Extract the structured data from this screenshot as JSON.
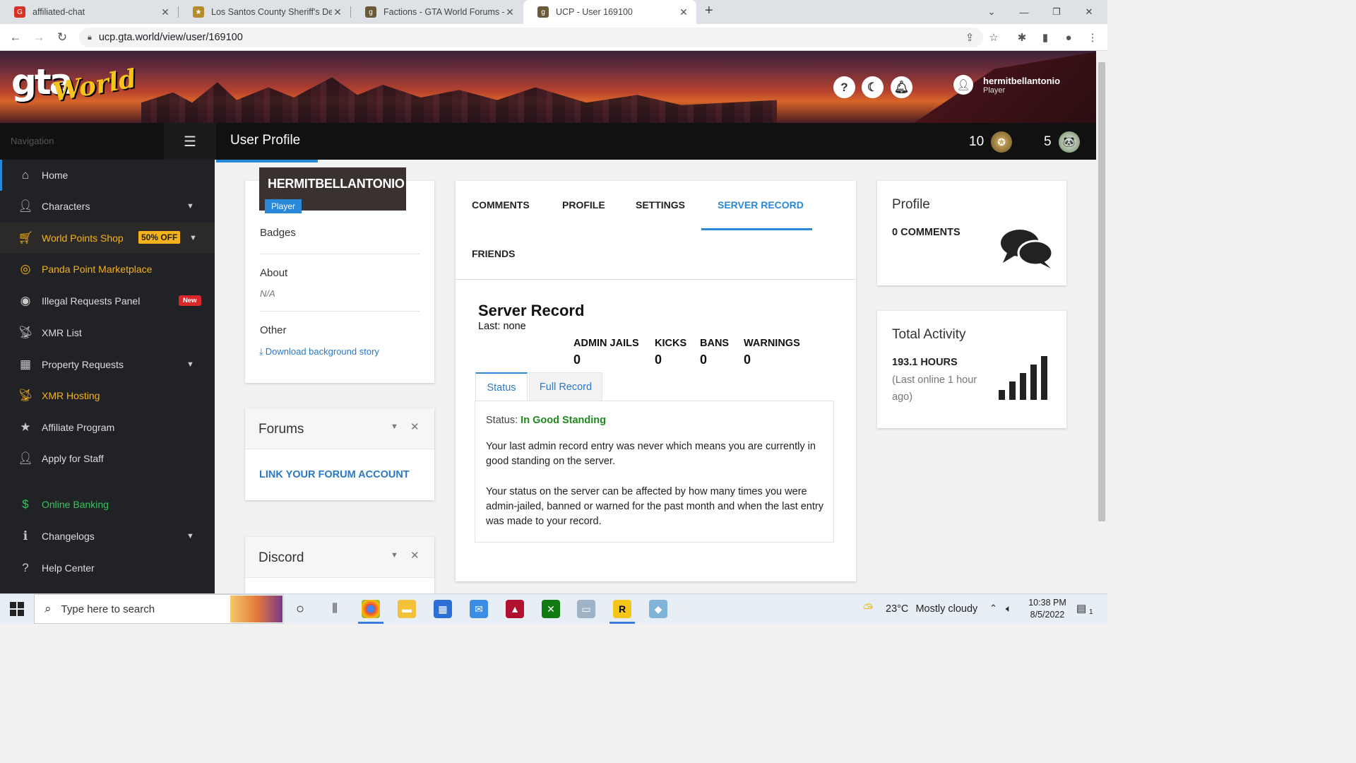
{
  "browser": {
    "tabs": [
      {
        "title": "affiliated-chat",
        "active": false
      },
      {
        "title": "Los Santos County Sheriff's Depa",
        "active": false
      },
      {
        "title": "Factions - GTA World Forums - G",
        "active": false
      },
      {
        "title": "UCP - User 169100",
        "active": true
      }
    ],
    "url": "ucp.gta.world/view/user/169100"
  },
  "header": {
    "logo_main": "gta",
    "logo_sub": "World",
    "help_icon": "?",
    "username": "hermitbellantonio",
    "role": "Player"
  },
  "topnav": {
    "nav_label": "Navigation",
    "page_title": "User Profile",
    "world_points": "10",
    "panda_points": "5"
  },
  "sidebar": {
    "items": [
      {
        "label": "Home",
        "icon": "home-icon"
      },
      {
        "label": "Characters",
        "icon": "user-icon"
      },
      {
        "label": "World Points Shop",
        "icon": "cart-icon",
        "badge": "50% OFF"
      },
      {
        "label": "Panda Point Marketplace",
        "icon": "coins-icon"
      },
      {
        "label": "Illegal Requests Panel",
        "icon": "mask-icon",
        "badge": "New"
      },
      {
        "label": "XMR List",
        "icon": "antenna-icon"
      },
      {
        "label": "Property Requests",
        "icon": "building-icon"
      },
      {
        "label": "XMR Hosting",
        "icon": "antenna-icon"
      },
      {
        "label": "Affiliate Program",
        "icon": "star-icon"
      },
      {
        "label": "Apply for Staff",
        "icon": "staff-icon"
      },
      {
        "label": "Online Banking",
        "icon": "dollar-icon"
      },
      {
        "label": "Changelogs",
        "icon": "info-icon"
      },
      {
        "label": "Help Center",
        "icon": "question-icon"
      }
    ]
  },
  "profile_card": {
    "username": "HERMITBELLANTONIO",
    "role": "Player",
    "badges_heading": "Badges",
    "about_heading": "About",
    "about_value": "N/A",
    "other_heading": "Other",
    "download_link": "Download background story"
  },
  "forums_card": {
    "title": "Forums",
    "link": "LINK YOUR FORUM ACCOUNT"
  },
  "discord_card": {
    "title": "Discord"
  },
  "main_tabs": [
    "COMMENTS",
    "PROFILE",
    "SETTINGS",
    "SERVER RECORD",
    "FRIENDS"
  ],
  "server_record": {
    "title": "Server Record",
    "last": "Last: none",
    "stats": [
      {
        "label": "ADMIN JAILS",
        "value": "0"
      },
      {
        "label": "KICKS",
        "value": "0"
      },
      {
        "label": "BANS",
        "value": "0"
      },
      {
        "label": "WARNINGS",
        "value": "0"
      }
    ],
    "subtabs": [
      "Status",
      "Full Record"
    ],
    "status_label": "Status:",
    "status_value": "In Good Standing",
    "para1": "Your last admin record entry was never which means you are currently in good standing on the server.",
    "para2": "Your status on the server can be affected by how many times you were admin-jailed, banned or warned for the past month and when the last entry was made to your record."
  },
  "profile_widget": {
    "title": "Profile",
    "comments": "0 COMMENTS"
  },
  "activity_widget": {
    "title": "Total Activity",
    "hours": "193.1 HOURS",
    "last_online": "(Last online 1 hour ago)"
  },
  "taskbar": {
    "search_placeholder": "Type here to search",
    "temperature": "23°C",
    "weather": "Mostly cloudy",
    "time": "10:38 PM",
    "date": "8/5/2022",
    "notifications": "1"
  },
  "colors": {
    "accent": "#2a88d8",
    "sidebar_bg": "#202226",
    "yellow": "#f5b21b",
    "green": "#38c35a",
    "good_standing": "#1e8a1e"
  }
}
